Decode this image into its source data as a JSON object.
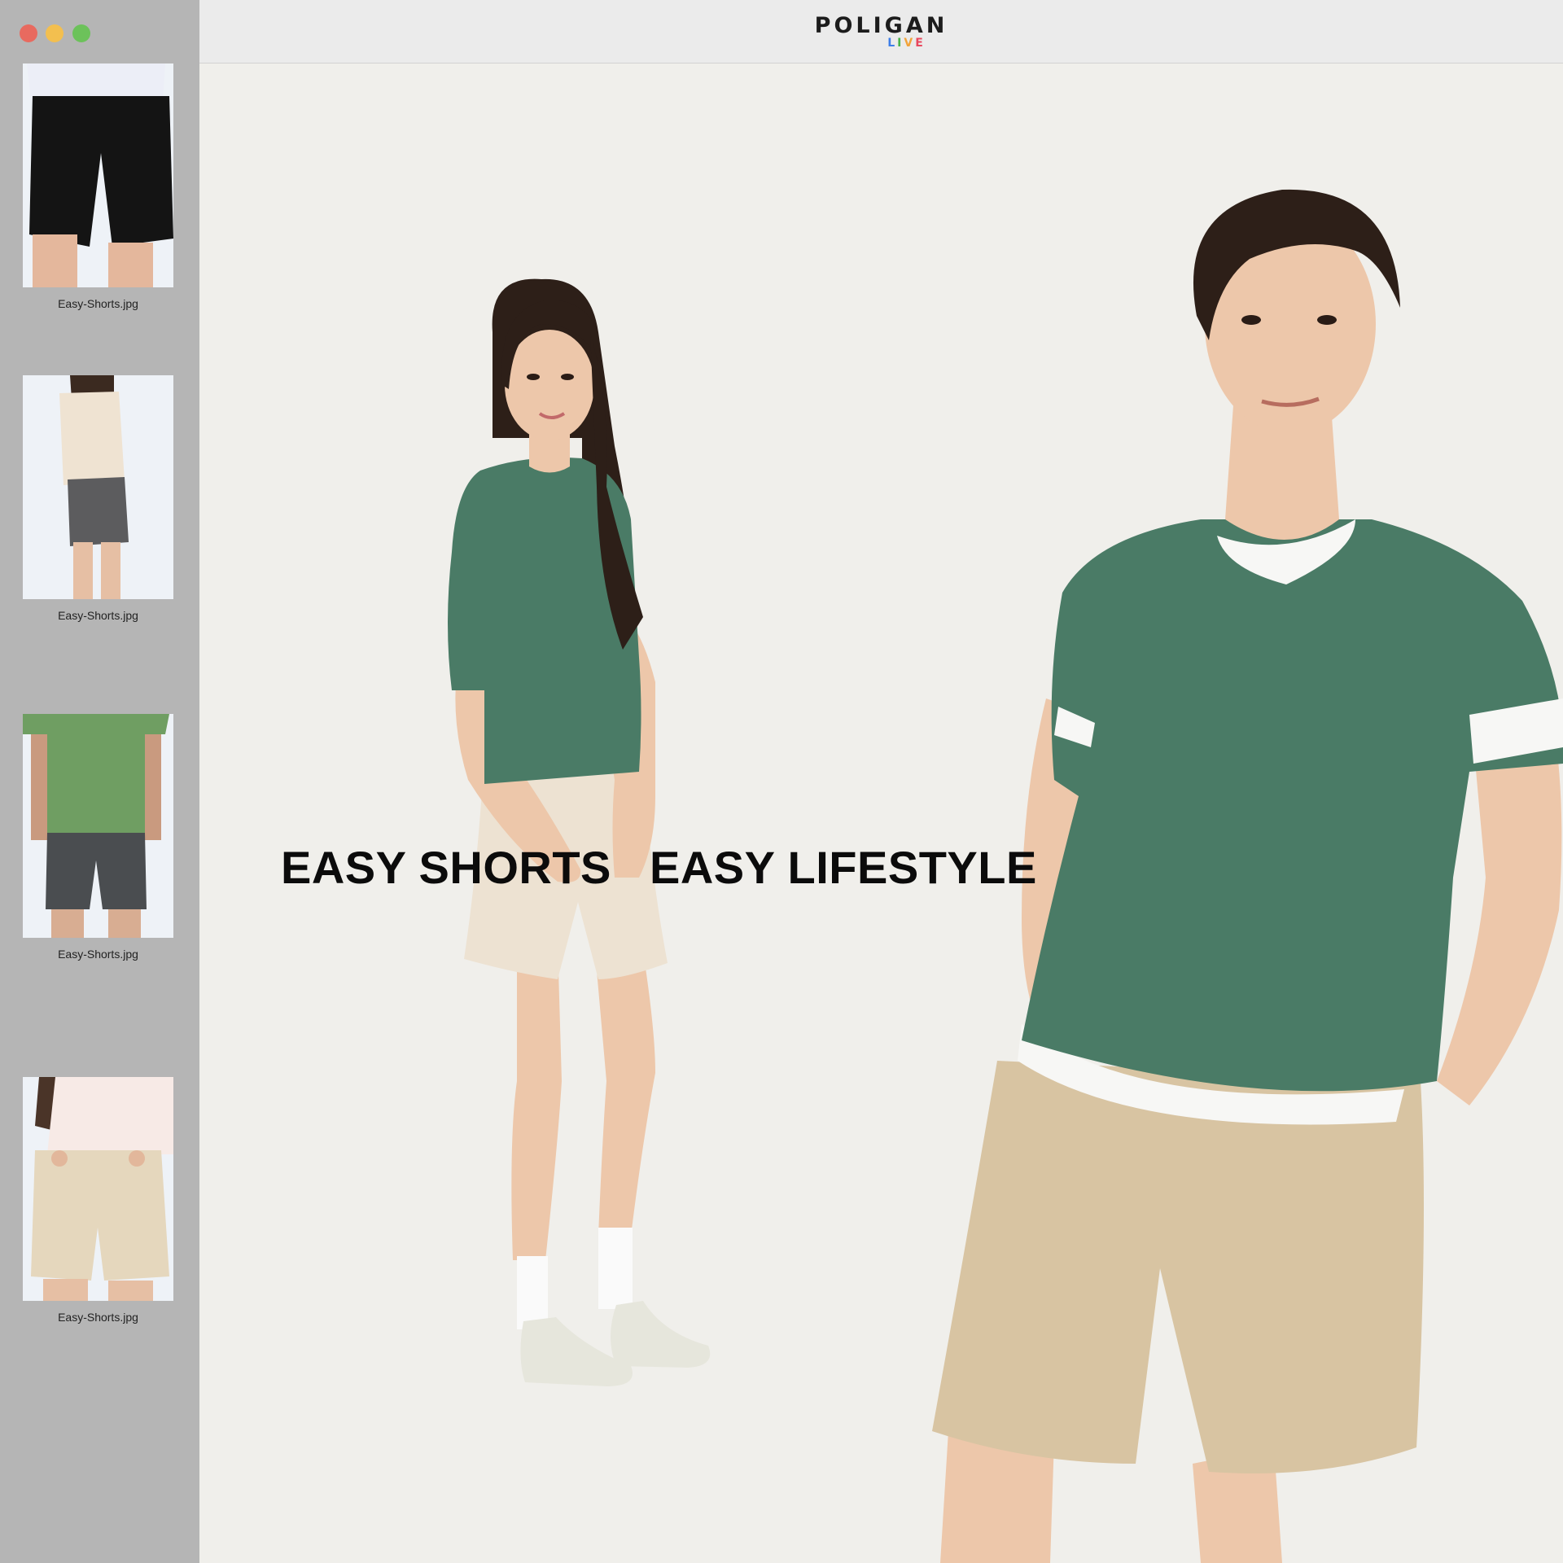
{
  "window": {
    "controls": [
      {
        "name": "close",
        "color": "#e86a5f"
      },
      {
        "name": "minimize",
        "color": "#f3bf4f"
      },
      {
        "name": "zoom",
        "color": "#6cc25a"
      }
    ]
  },
  "brand": {
    "name": "POLIGAN",
    "sub_letters": [
      {
        "char": "L",
        "color": "#3d7ee8"
      },
      {
        "char": "I",
        "color": "#48b34a"
      },
      {
        "char": "V",
        "color": "#f2a33a"
      },
      {
        "char": "E",
        "color": "#e8485e"
      }
    ]
  },
  "sidebar": {
    "thumbnails": [
      {
        "filename": "Easy-Shorts.jpg",
        "shirt_color": "#eceef7",
        "shorts_color": "#141414"
      },
      {
        "filename": "Easy-Shorts.jpg",
        "shirt_color": "#efe3d2",
        "shorts_color": "#5c5c5e"
      },
      {
        "filename": "Easy-Shorts.jpg",
        "shirt_color": "#6f9e62",
        "shorts_color": "#4a4d50"
      },
      {
        "filename": "Easy-Shorts.jpg",
        "shirt_color": "#f7eae6",
        "shorts_color": "#e5d7bd"
      }
    ]
  },
  "hero": {
    "headline_left": "EASY SHORTS",
    "headline_right": "EASY LIFESTYLE",
    "colors": {
      "tee_green": "#4a7b66",
      "skin": "#edc7aa",
      "hair": "#2d1f18",
      "woman_shorts": "#ede2d2",
      "man_shorts": "#d8c4a2",
      "socks": "#fafafa",
      "sneakers": "#e6e6dc"
    }
  }
}
